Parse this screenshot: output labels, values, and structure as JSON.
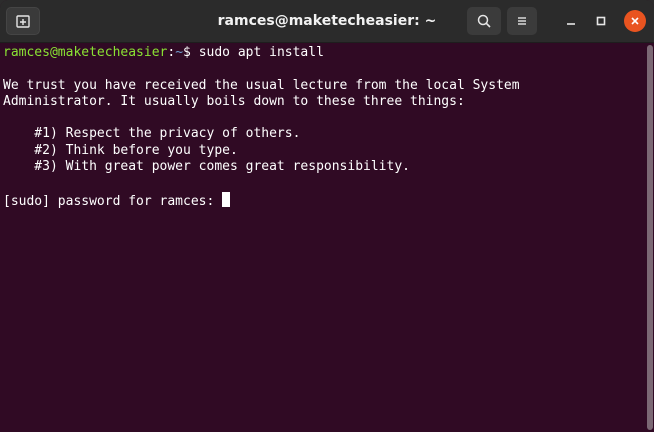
{
  "window": {
    "title": "ramces@maketecheasier: ~"
  },
  "icons": {
    "new_tab": "new-tab-icon",
    "search": "search-icon",
    "menu": "hamburger-menu-icon",
    "minimize": "minimize-icon",
    "maximize": "maximize-icon",
    "close": "close-icon"
  },
  "terminal": {
    "prompt_user": "ramces@maketecheasier",
    "prompt_sep": ":",
    "prompt_path": "~",
    "prompt_symbol": "$ ",
    "command": "sudo apt install",
    "lecture_line1": "We trust you have received the usual lecture from the local System",
    "lecture_line2": "Administrator. It usually boils down to these three things:",
    "rule1": "    #1) Respect the privacy of others.",
    "rule2": "    #2) Think before you type.",
    "rule3": "    #3) With great power comes great responsibility.",
    "password_prompt": "[sudo] password for ramces: "
  },
  "colors": {
    "background": "#300a24",
    "prompt_user": "#8ae234",
    "prompt_path": "#729fcf",
    "close_button": "#e95420"
  }
}
